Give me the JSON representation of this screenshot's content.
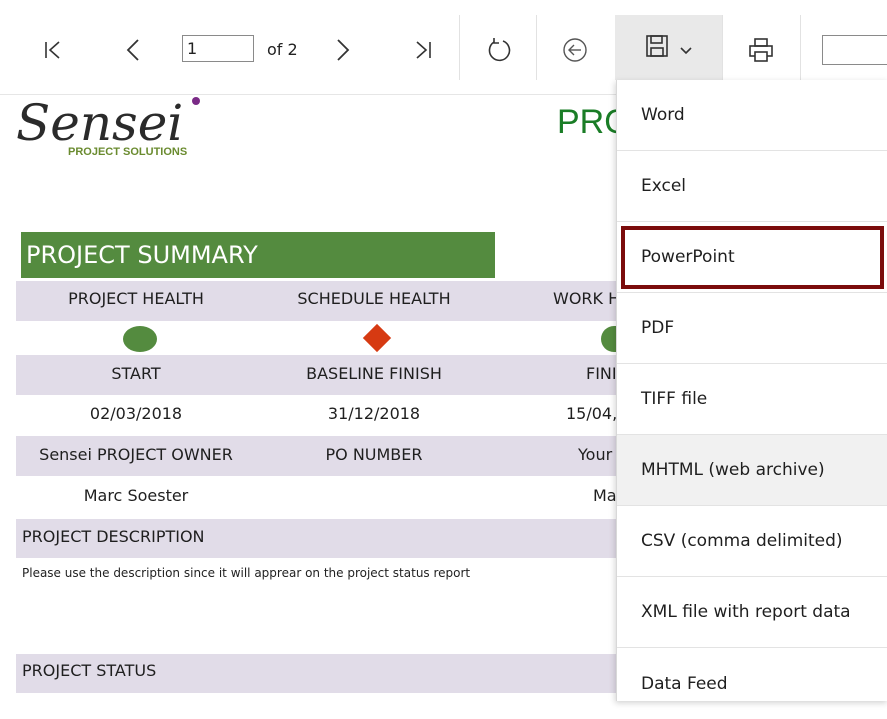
{
  "toolbar": {
    "page_number": "1",
    "page_of": "of 2",
    "icons": [
      "first-page-icon",
      "previous-page-icon",
      "next-page-icon",
      "last-page-icon",
      "refresh-icon",
      "back-icon",
      "save-icon",
      "chevron-down-icon",
      "print-icon"
    ]
  },
  "logo": {
    "wordmark": "Sensei",
    "tagline": "PROJECT SOLUTIONS"
  },
  "report": {
    "heading": "PRO",
    "section_title": "PROJECT SUMMARY",
    "row1": [
      "PROJECT HEALTH",
      "SCHEDULE HEALTH",
      "WORK H"
    ],
    "row3": [
      "START",
      "BASELINE FINISH",
      "FINI"
    ],
    "row4": [
      "02/03/2018",
      "31/12/2018",
      "15/04,"
    ],
    "row5": [
      "Sensei PROJECT OWNER",
      "PO NUMBER",
      "Your"
    ],
    "row6": [
      "Marc Soester",
      "",
      "Ma"
    ],
    "description_label": "PROJECT DESCRIPTION",
    "description_text": "Please use the description since it will apprear on the project status report",
    "status_label": "PROJECT STATUS",
    "colors": {
      "green": "#548b3f",
      "red": "#d63a12",
      "band": "#e1dce8"
    }
  },
  "export_menu": {
    "items": [
      "Word",
      "Excel",
      "PowerPoint",
      "PDF",
      "TIFF file",
      "MHTML (web archive)",
      "CSV (comma delimited)",
      "XML file with report data",
      "Data Feed"
    ],
    "highlighted": "PowerPoint",
    "hovered": "MHTML (web archive)",
    "highlight_color": "#7b0c0c"
  }
}
